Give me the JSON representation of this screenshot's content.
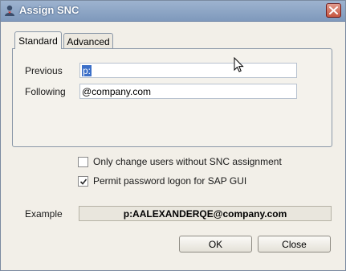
{
  "window": {
    "title": "Assign SNC"
  },
  "tabs": [
    {
      "label": "Standard",
      "active": true
    },
    {
      "label": "Advanced",
      "active": false
    }
  ],
  "fields": {
    "previous": {
      "label": "Previous",
      "value": "p:"
    },
    "following": {
      "label": "Following",
      "value": "@company.com"
    }
  },
  "options": {
    "only_change": {
      "label": "Only change users without SNC assignment",
      "checked": false
    },
    "permit_password": {
      "label": "Permit password logon for SAP GUI",
      "checked": true
    }
  },
  "example": {
    "label": "Example",
    "value": "p:AALEXANDERQE@company.com"
  },
  "buttons": {
    "ok": "OK",
    "close": "Close"
  },
  "icons": {
    "app": "sap-user-icon",
    "close": "close-icon",
    "check": "checkmark-icon",
    "cursor": "mouse-pointer-icon"
  },
  "colors": {
    "titlebar": "#8aa4c6",
    "selection": "#3b6fc8",
    "close_button": "#c5553f"
  }
}
